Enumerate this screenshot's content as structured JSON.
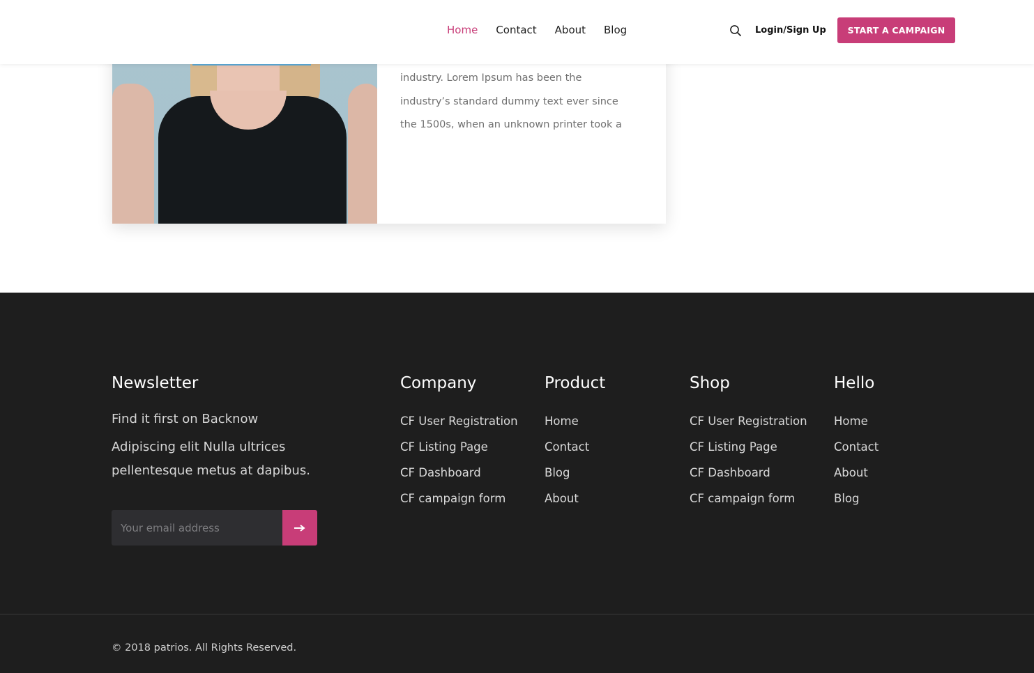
{
  "header": {
    "nav": [
      "Home",
      "Contact",
      "About",
      "Blog"
    ],
    "active_nav": "Home",
    "login_label": "Login/Sign Up",
    "cta_label": "START A CAMPAIGN",
    "accent_color": "#c83d78"
  },
  "card": {
    "lines": [
      "industry. Lorem Ipsum has been the",
      "industry’s standard dummy text ever since",
      "the 1500s, when an unknown printer took a"
    ]
  },
  "footer": {
    "newsletter": {
      "title": "Newsletter",
      "subtitle": "Find it first on Backnow",
      "description": "Adipiscing elit Nulla ultrices pellentesque metus at dapibus.",
      "email_placeholder": "Your email address",
      "submit_icon": "arrow-right-icon"
    },
    "company": {
      "title": "Company",
      "items": [
        "CF User Registration",
        "CF Listing Page",
        "CF Dashboard",
        "CF campaign form"
      ]
    },
    "product": {
      "title": "Product",
      "items": [
        "Home",
        "Contact",
        "Blog",
        "About"
      ]
    },
    "shop": {
      "title": "Shop",
      "items": [
        "CF User Registration",
        "CF Listing Page",
        "CF Dashboard",
        "CF campaign form"
      ]
    },
    "hello": {
      "title": "Hello",
      "items": [
        "Home",
        "Contact",
        "About",
        "Blog"
      ]
    },
    "copyright": "© 2018 patrios. All Rights Reserved."
  }
}
